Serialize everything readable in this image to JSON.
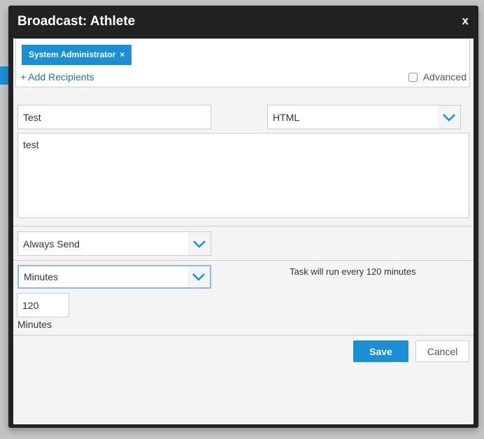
{
  "modal": {
    "title": "Broadcast: Athlete",
    "close_label": "x"
  },
  "recipients": {
    "chips": [
      {
        "label": "System Administrator",
        "remove": "×"
      }
    ],
    "add_label": "+ Add Recipients",
    "advanced_label": "Advanced",
    "advanced_checked": false
  },
  "message": {
    "subject": "Test",
    "format": "HTML",
    "body": "test"
  },
  "send_condition": {
    "value": "Always Send"
  },
  "schedule": {
    "unit": "Minutes",
    "summary": "Task will run every 120 minutes",
    "interval": "120",
    "interval_label": "Minutes"
  },
  "actions": {
    "save": "Save",
    "cancel": "Cancel"
  },
  "colors": {
    "accent": "#1a8fd6",
    "header": "#222222"
  }
}
